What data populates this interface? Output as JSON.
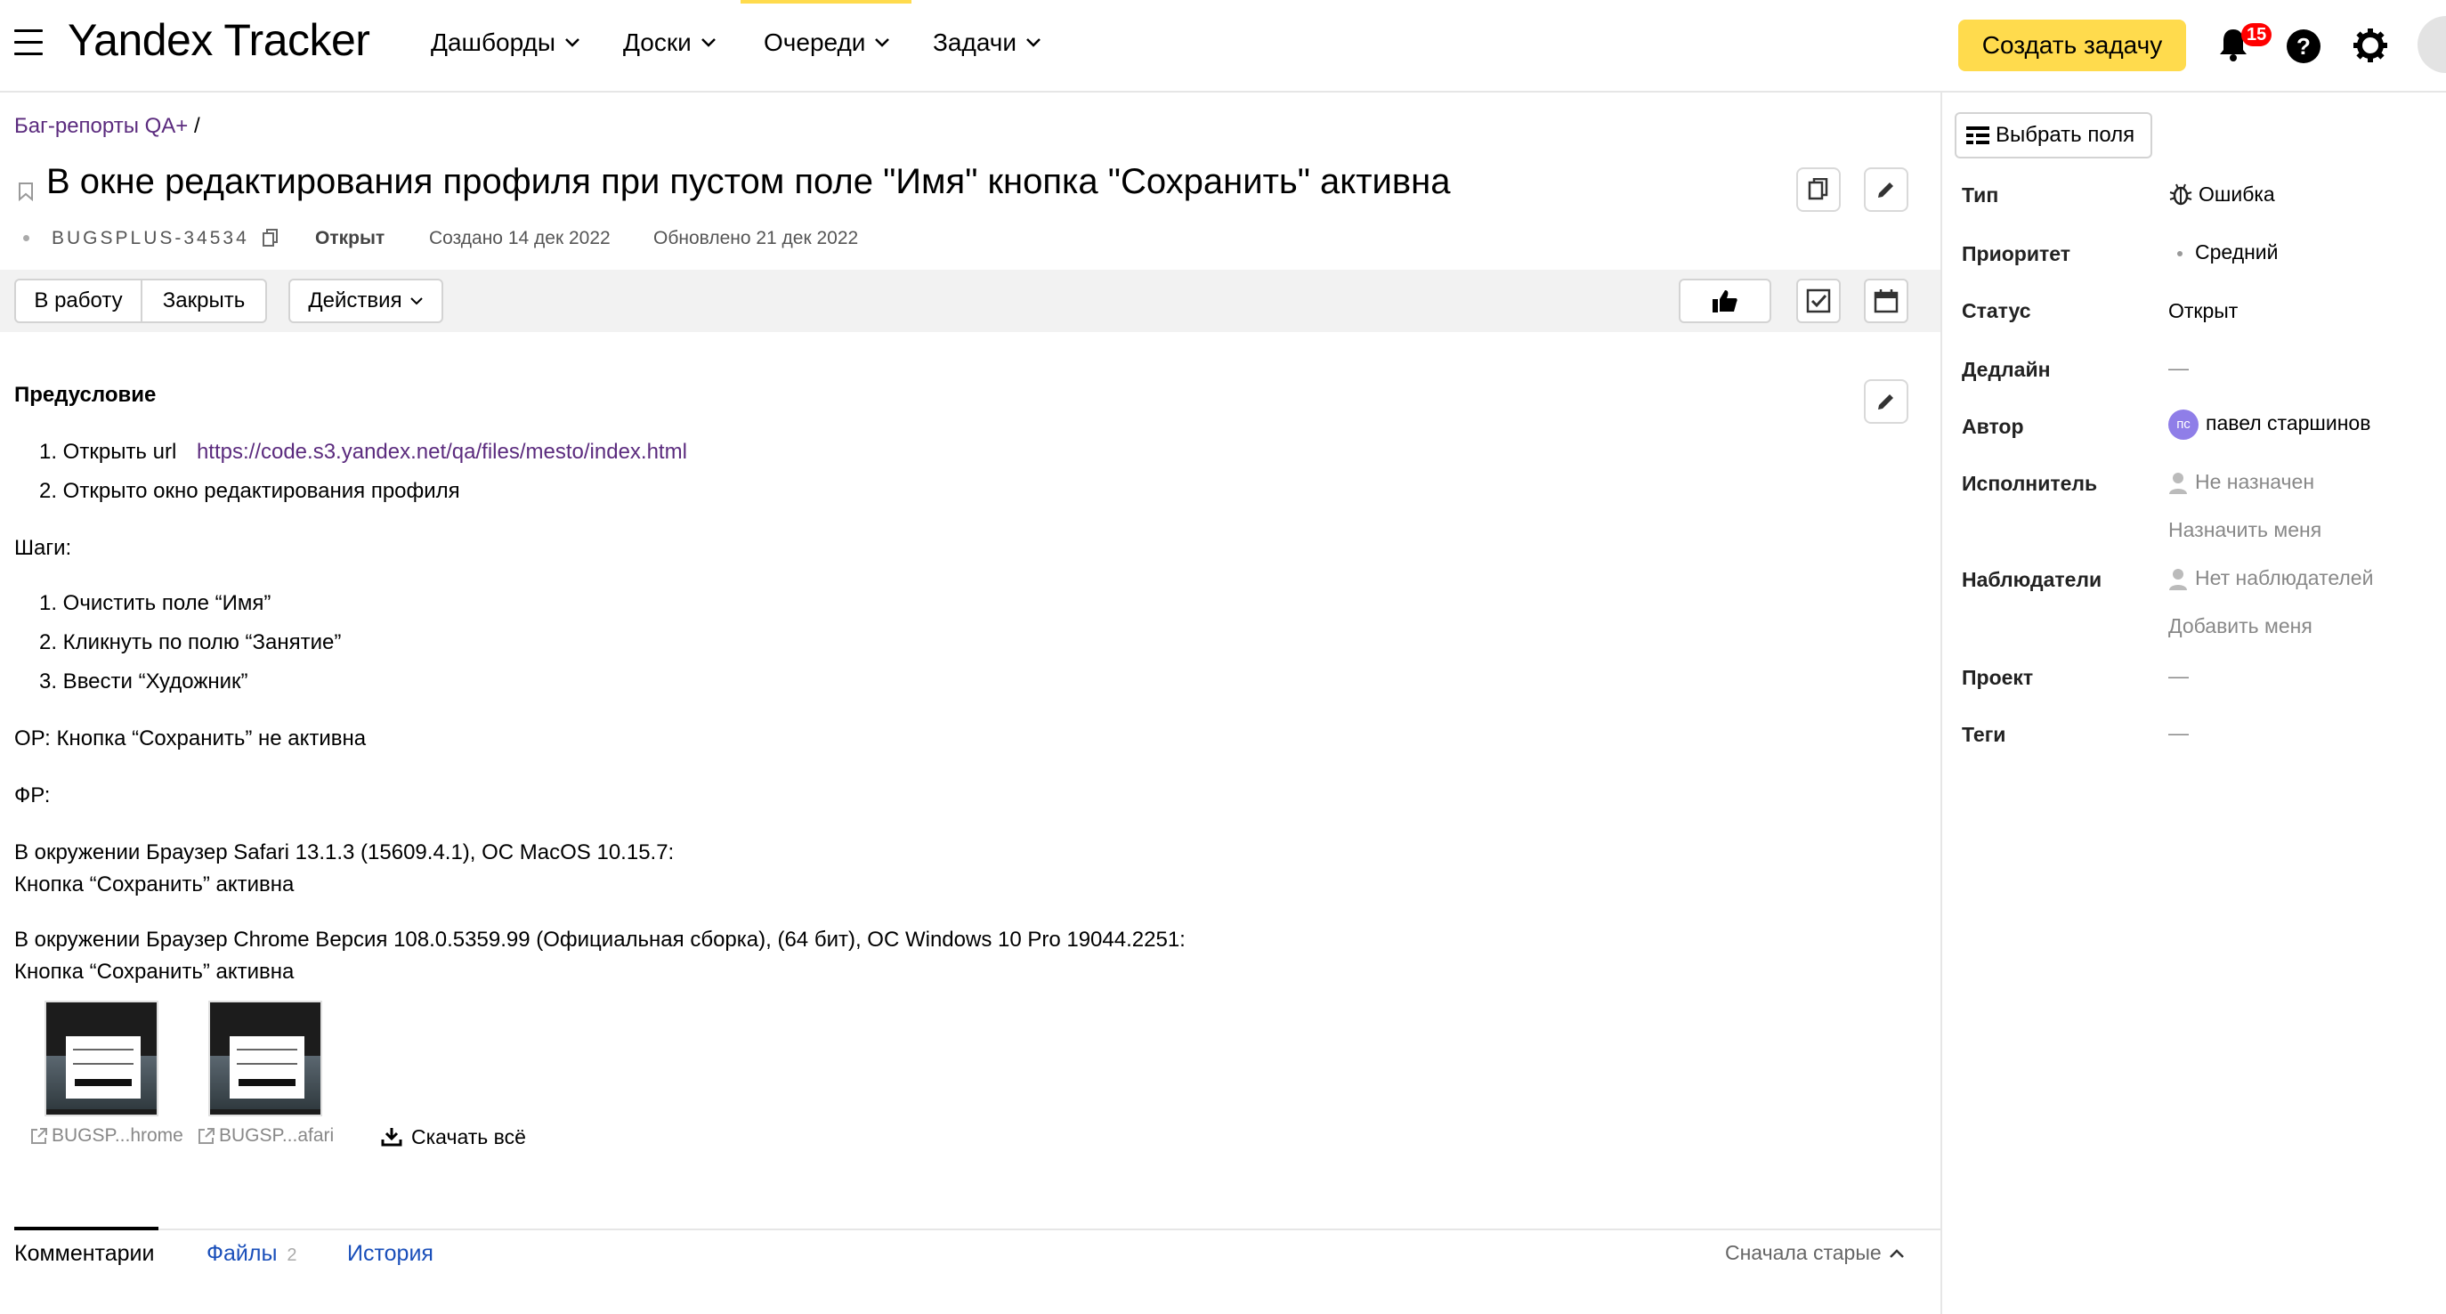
{
  "header": {
    "logo": "Yandex Tracker",
    "nav": [
      "Дашборды",
      "Доски",
      "Очереди",
      "Задачи"
    ],
    "create_button": "Создать задачу",
    "notifications_count": "15"
  },
  "issue": {
    "breadcrumb": "Баг-репорты QA+",
    "breadcrumb_sep": "/",
    "title": "В окне редактирования профиля при пустом поле \"Имя\" кнопка \"Сохранить\" активна",
    "key": "BUGSPLUS-34534",
    "status": "Открыт",
    "created": "Создано 14 дек 2022",
    "updated": "Обновлено 21 дек 2022"
  },
  "toolbar": {
    "to_work": "В работу",
    "close": "Закрыть",
    "actions": "Действия"
  },
  "description": {
    "precondition_heading": "Предусловие",
    "pre_item1_prefix": "1. Открыть url",
    "pre_item1_url": "https://code.s3.yandex.net/qa/files/mesto/index.html",
    "pre_item2": "2. Открыто окно редактирования профиля",
    "steps_heading": "Шаги:",
    "step1": "1. Очистить поле “Имя”",
    "step2": "2. Кликнуть по полю “Занятие”",
    "step3": "3. Ввести “Художник”",
    "expected": "ОР: Кнопка “Сохранить” не активна",
    "actual": "ФР:",
    "env1_line1": "В окружении Браузер Safari 13.1.3 (15609.4.1), ОС MacOS 10.15.7:",
    "env1_line2": "Кнопка “Сохранить” активна",
    "env2_line1": "В окружении Браузер Chrome Версия 108.0.5359.99 (Официальная сборка), (64 бит), ОС Windows 10 Pro 19044.2251:",
    "env2_line2": "Кнопка “Сохранить” активна"
  },
  "attachments": {
    "file1": "BUGSP...hrome",
    "file2": "BUGSP...afari",
    "download_all": "Скачать всё"
  },
  "tabs": {
    "comments": "Комментарии",
    "files": "Файлы",
    "files_count": "2",
    "history": "История",
    "sort": "Сначала старые"
  },
  "sidebar": {
    "choose_fields": "Выбрать поля",
    "type_label": "Тип",
    "type_value": "Ошибка",
    "priority_label": "Приоритет",
    "priority_value": "Средний",
    "status_label": "Статус",
    "status_value": "Открыт",
    "deadline_label": "Дедлайн",
    "deadline_value": "—",
    "author_label": "Автор",
    "author_initials": "пс",
    "author_value": "павел старшинов",
    "assignee_label": "Исполнитель",
    "assignee_value": "Не назначен",
    "assign_me": "Назначить меня",
    "watchers_label": "Наблюдатели",
    "watchers_value": "Нет наблюдателей",
    "add_me": "Добавить меня",
    "project_label": "Проект",
    "project_value": "—",
    "tags_label": "Теги",
    "tags_value": "—"
  },
  "colors": {
    "accent": "#ffdb4d",
    "link": "#5b2b7e",
    "tab_link": "#1a4fba",
    "badge": "#ff0000"
  }
}
